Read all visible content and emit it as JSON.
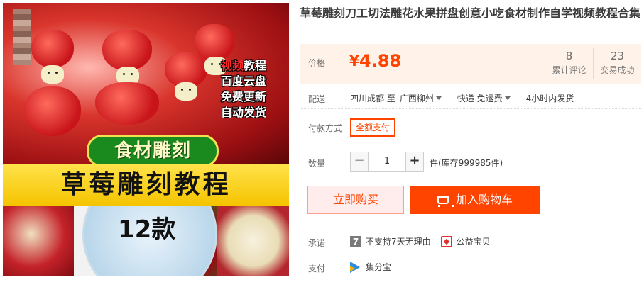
{
  "product": {
    "title": "草莓雕刻刀工切法雕花水果拼盘创意小吃食材制作自学视频教程合集",
    "image": {
      "promo_lines": [
        "视频教程",
        "百度云盘",
        "免费更新",
        "自动发货"
      ],
      "promo_highlight": "视频",
      "subtitle": "食材雕刻",
      "banner": "草莓雕刻教程",
      "count": "12款"
    }
  },
  "price": {
    "label": "价格",
    "currency": "¥",
    "value": "4.88",
    "reviews_value": "8",
    "reviews_label": "累计评论",
    "sales_value": "23",
    "sales_label": "交易成功"
  },
  "shipping": {
    "label": "配送",
    "from": "四川成都 至",
    "to": "广西柳州",
    "method": "快递 免运费",
    "ship_time": "4小时内发货"
  },
  "payment_method": {
    "label": "付款方式",
    "option": "全额支付"
  },
  "quantity": {
    "label": "数量",
    "minus": "−",
    "value": "1",
    "plus": "+",
    "stock": "件(库存999985件)"
  },
  "actions": {
    "buy_now": "立即购买",
    "add_to_cart": "加入购物车"
  },
  "promise": {
    "label": "承诺",
    "icon_text": "7",
    "no_return": "不支持7天无理由",
    "charity": "公益宝贝"
  },
  "pay": {
    "label": "支付",
    "method": "集分宝"
  },
  "colors": {
    "accent": "#ff4400",
    "price_bg": "#fff2e8"
  }
}
